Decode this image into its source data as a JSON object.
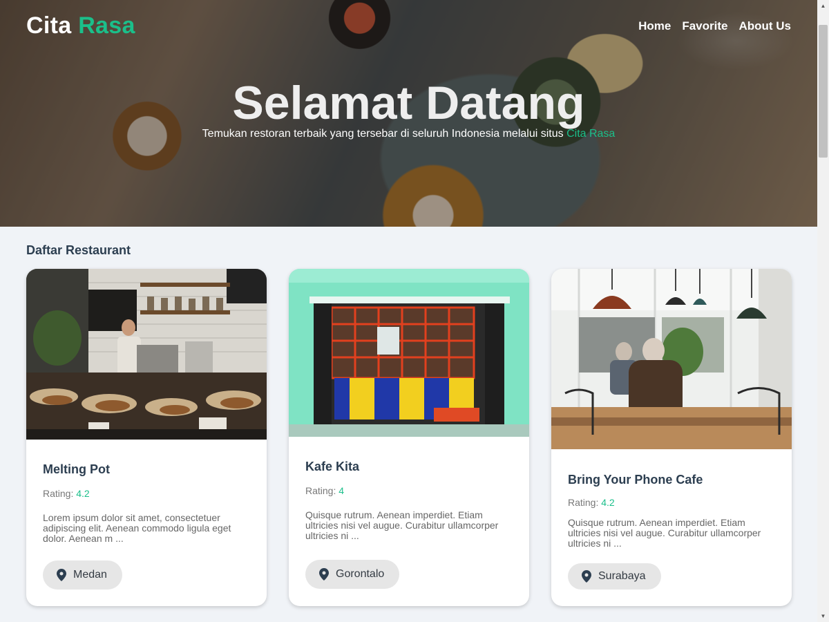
{
  "brand": {
    "name_part1": "Cita",
    "name_part2": "Rasa"
  },
  "nav": {
    "items": [
      "Home",
      "Favorite",
      "About Us"
    ]
  },
  "hero": {
    "title": "Selamat Datang",
    "subtitle": "Temukan restoran terbaik yang tersebar di seluruh Indonesia melalui situs",
    "subtitle_highlight": "Cita Rasa"
  },
  "section": {
    "title": "Daftar Restaurant"
  },
  "restaurants": [
    {
      "name": "Melting Pot",
      "rating_label": "Rating:",
      "rating": "4.2",
      "description": "Lorem ipsum dolor sit amet, consectetuer adipiscing elit. Aenean commodo ligula eget dolor. Aenean m ...",
      "city": "Medan"
    },
    {
      "name": "Kafe Kita",
      "rating_label": "Rating:",
      "rating": "4",
      "description": "Quisque rutrum. Aenean imperdiet. Etiam ultricies nisi vel augue. Curabitur ullamcorper ultricies ni ...",
      "city": "Gorontalo"
    },
    {
      "name": "Bring Your Phone Cafe",
      "rating_label": "Rating:",
      "rating": "4.2",
      "description": "Quisque rutrum. Aenean imperdiet. Etiam ultricies nisi vel augue. Curabitur ullamcorper ultricies ni ...",
      "city": "Surabaya"
    }
  ],
  "colors": {
    "accent": "#1bbf8a",
    "text_dark": "#2c3e50",
    "page_bg": "#f0f3f7"
  },
  "icons": {
    "location": "map-pin-icon"
  }
}
